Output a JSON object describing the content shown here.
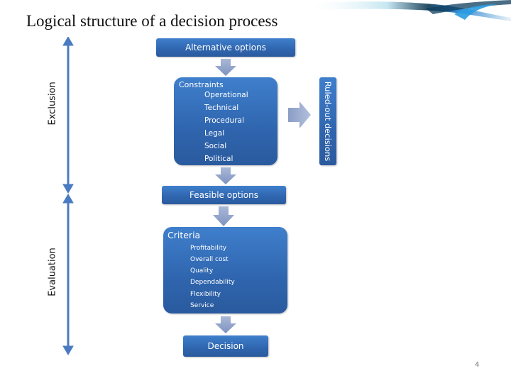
{
  "slide": {
    "title": "Logical structure of a decision process",
    "page_number": "4"
  },
  "axis_labels": {
    "exclusion": "Exclusion",
    "evaluation": "Evaluation"
  },
  "flow": {
    "alternative_options": "Alternative options",
    "constraints": {
      "heading": "Constraints",
      "items": [
        "Operational",
        "Technical",
        "Procedural",
        "Legal",
        "Social",
        "Political"
      ]
    },
    "ruled_out": "Ruled-out decisions",
    "feasible_options": "Feasible options",
    "criteria": {
      "heading": "Criteria",
      "items": [
        "Profitability",
        "Overall cost",
        "Quality",
        "Dependability",
        "Flexibility",
        "Service"
      ]
    },
    "decision": "Decision"
  },
  "colors": {
    "box_blue": "#3572bd",
    "arrow_gray_blue": "#8fa2c8",
    "axis_arrow": "#4a7bc0"
  }
}
